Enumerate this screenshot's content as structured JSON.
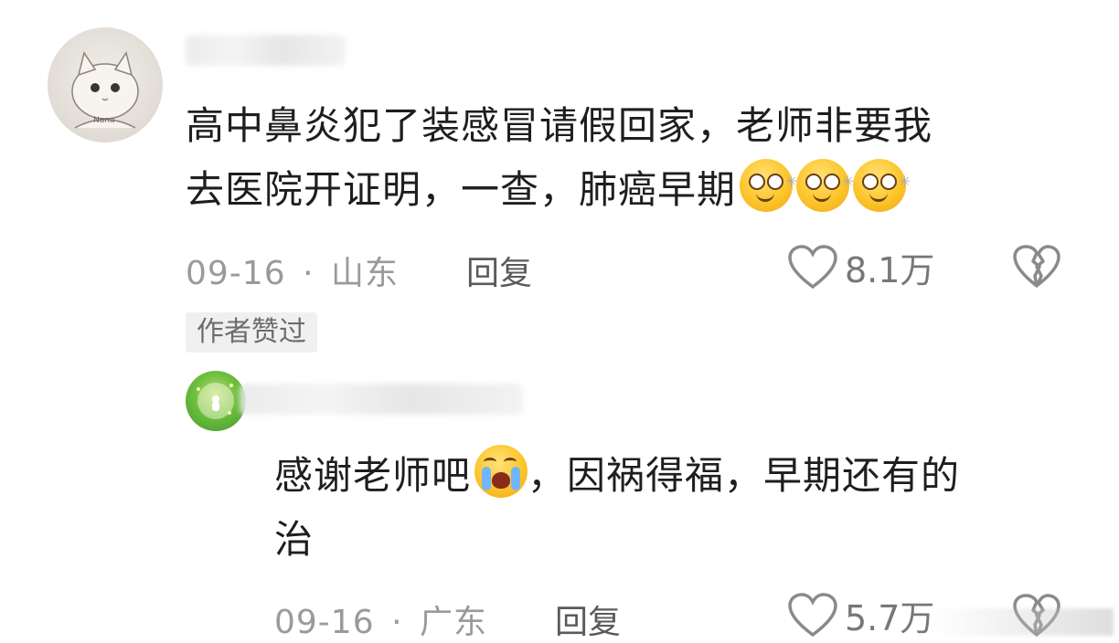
{
  "comments": [
    {
      "text_line1": "高中鼻炎犯了装感冒请假回家，老师非要我",
      "text_line2": "去医院开证明，一查，肺癌早期",
      "date": "09-16",
      "separator": "·",
      "location": "山东",
      "reply_label": "回复",
      "likes": "8.1万",
      "badge": "作者赞过",
      "avatar_label": "Nana",
      "emojis": [
        "dizzy-smile-emoji",
        "dizzy-smile-emoji",
        "dizzy-smile-emoji"
      ]
    },
    {
      "text_line1_part1": "感谢老师吧",
      "text_line1_part2": "，因祸得福，早期还有的",
      "text_line2": "治",
      "date": "09-16",
      "separator": "·",
      "location": "广东",
      "reply_label": "回复",
      "likes": "5.7万",
      "emojis": [
        "crying-emoji"
      ]
    }
  ],
  "colors": {
    "meta_gray": "#9a9a9a",
    "badge_bg": "#f0f0f0",
    "text": "#1e1e1e",
    "avatar_green": "#6fbf3f"
  }
}
